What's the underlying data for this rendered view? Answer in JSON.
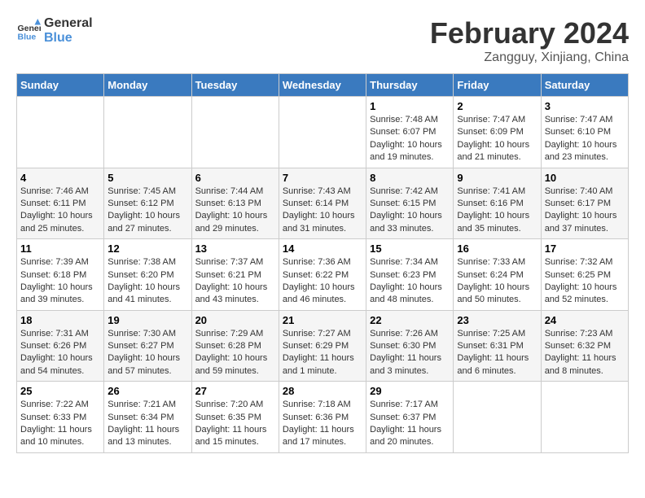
{
  "logo": {
    "line1": "General",
    "line2": "Blue"
  },
  "title": "February 2024",
  "subtitle": "Zangguy, Xinjiang, China",
  "weekdays": [
    "Sunday",
    "Monday",
    "Tuesday",
    "Wednesday",
    "Thursday",
    "Friday",
    "Saturday"
  ],
  "weeks": [
    [
      {
        "day": "",
        "info": ""
      },
      {
        "day": "",
        "info": ""
      },
      {
        "day": "",
        "info": ""
      },
      {
        "day": "",
        "info": ""
      },
      {
        "day": "1",
        "info": "Sunrise: 7:48 AM\nSunset: 6:07 PM\nDaylight: 10 hours and 19 minutes."
      },
      {
        "day": "2",
        "info": "Sunrise: 7:47 AM\nSunset: 6:09 PM\nDaylight: 10 hours and 21 minutes."
      },
      {
        "day": "3",
        "info": "Sunrise: 7:47 AM\nSunset: 6:10 PM\nDaylight: 10 hours and 23 minutes."
      }
    ],
    [
      {
        "day": "4",
        "info": "Sunrise: 7:46 AM\nSunset: 6:11 PM\nDaylight: 10 hours and 25 minutes."
      },
      {
        "day": "5",
        "info": "Sunrise: 7:45 AM\nSunset: 6:12 PM\nDaylight: 10 hours and 27 minutes."
      },
      {
        "day": "6",
        "info": "Sunrise: 7:44 AM\nSunset: 6:13 PM\nDaylight: 10 hours and 29 minutes."
      },
      {
        "day": "7",
        "info": "Sunrise: 7:43 AM\nSunset: 6:14 PM\nDaylight: 10 hours and 31 minutes."
      },
      {
        "day": "8",
        "info": "Sunrise: 7:42 AM\nSunset: 6:15 PM\nDaylight: 10 hours and 33 minutes."
      },
      {
        "day": "9",
        "info": "Sunrise: 7:41 AM\nSunset: 6:16 PM\nDaylight: 10 hours and 35 minutes."
      },
      {
        "day": "10",
        "info": "Sunrise: 7:40 AM\nSunset: 6:17 PM\nDaylight: 10 hours and 37 minutes."
      }
    ],
    [
      {
        "day": "11",
        "info": "Sunrise: 7:39 AM\nSunset: 6:18 PM\nDaylight: 10 hours and 39 minutes."
      },
      {
        "day": "12",
        "info": "Sunrise: 7:38 AM\nSunset: 6:20 PM\nDaylight: 10 hours and 41 minutes."
      },
      {
        "day": "13",
        "info": "Sunrise: 7:37 AM\nSunset: 6:21 PM\nDaylight: 10 hours and 43 minutes."
      },
      {
        "day": "14",
        "info": "Sunrise: 7:36 AM\nSunset: 6:22 PM\nDaylight: 10 hours and 46 minutes."
      },
      {
        "day": "15",
        "info": "Sunrise: 7:34 AM\nSunset: 6:23 PM\nDaylight: 10 hours and 48 minutes."
      },
      {
        "day": "16",
        "info": "Sunrise: 7:33 AM\nSunset: 6:24 PM\nDaylight: 10 hours and 50 minutes."
      },
      {
        "day": "17",
        "info": "Sunrise: 7:32 AM\nSunset: 6:25 PM\nDaylight: 10 hours and 52 minutes."
      }
    ],
    [
      {
        "day": "18",
        "info": "Sunrise: 7:31 AM\nSunset: 6:26 PM\nDaylight: 10 hours and 54 minutes."
      },
      {
        "day": "19",
        "info": "Sunrise: 7:30 AM\nSunset: 6:27 PM\nDaylight: 10 hours and 57 minutes."
      },
      {
        "day": "20",
        "info": "Sunrise: 7:29 AM\nSunset: 6:28 PM\nDaylight: 10 hours and 59 minutes."
      },
      {
        "day": "21",
        "info": "Sunrise: 7:27 AM\nSunset: 6:29 PM\nDaylight: 11 hours and 1 minute."
      },
      {
        "day": "22",
        "info": "Sunrise: 7:26 AM\nSunset: 6:30 PM\nDaylight: 11 hours and 3 minutes."
      },
      {
        "day": "23",
        "info": "Sunrise: 7:25 AM\nSunset: 6:31 PM\nDaylight: 11 hours and 6 minutes."
      },
      {
        "day": "24",
        "info": "Sunrise: 7:23 AM\nSunset: 6:32 PM\nDaylight: 11 hours and 8 minutes."
      }
    ],
    [
      {
        "day": "25",
        "info": "Sunrise: 7:22 AM\nSunset: 6:33 PM\nDaylight: 11 hours and 10 minutes."
      },
      {
        "day": "26",
        "info": "Sunrise: 7:21 AM\nSunset: 6:34 PM\nDaylight: 11 hours and 13 minutes."
      },
      {
        "day": "27",
        "info": "Sunrise: 7:20 AM\nSunset: 6:35 PM\nDaylight: 11 hours and 15 minutes."
      },
      {
        "day": "28",
        "info": "Sunrise: 7:18 AM\nSunset: 6:36 PM\nDaylight: 11 hours and 17 minutes."
      },
      {
        "day": "29",
        "info": "Sunrise: 7:17 AM\nSunset: 6:37 PM\nDaylight: 11 hours and 20 minutes."
      },
      {
        "day": "",
        "info": ""
      },
      {
        "day": "",
        "info": ""
      }
    ]
  ]
}
